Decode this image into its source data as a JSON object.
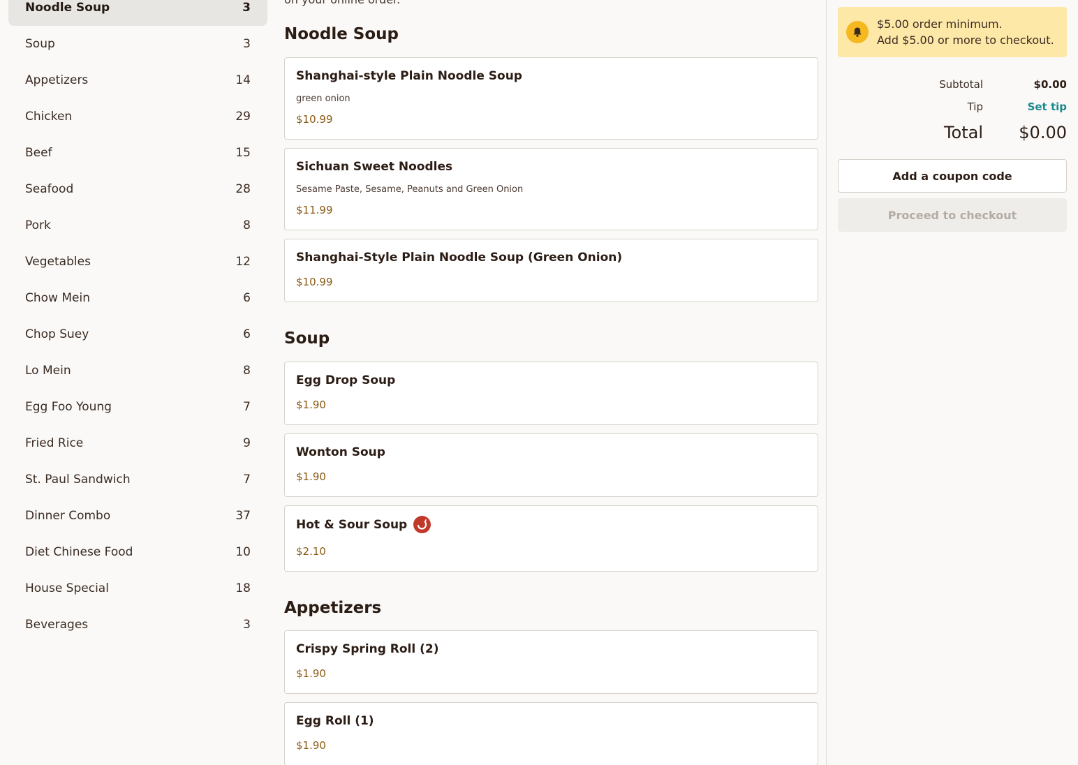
{
  "sidebar": {
    "categories": [
      {
        "label": "Noodle Soup",
        "count": "3"
      },
      {
        "label": "Soup",
        "count": "3"
      },
      {
        "label": "Appetizers",
        "count": "14"
      },
      {
        "label": "Chicken",
        "count": "29"
      },
      {
        "label": "Beef",
        "count": "15"
      },
      {
        "label": "Seafood",
        "count": "28"
      },
      {
        "label": "Pork",
        "count": "8"
      },
      {
        "label": "Vegetables",
        "count": "12"
      },
      {
        "label": "Chow Mein",
        "count": "6"
      },
      {
        "label": "Chop Suey",
        "count": "6"
      },
      {
        "label": "Lo Mein",
        "count": "8"
      },
      {
        "label": "Egg Foo Young",
        "count": "7"
      },
      {
        "label": "Fried Rice",
        "count": "9"
      },
      {
        "label": "St. Paul Sandwich",
        "count": "7"
      },
      {
        "label": "Dinner Combo",
        "count": "37"
      },
      {
        "label": "Diet Chinese Food",
        "count": "10"
      },
      {
        "label": "House Special",
        "count": "18"
      },
      {
        "label": "Beverages",
        "count": "3"
      }
    ]
  },
  "menu": {
    "intro": "on your online order.",
    "sections": [
      {
        "title": "Noodle Soup",
        "items": [
          {
            "name": "Shanghai-style Plain Noodle Soup",
            "desc": "green onion",
            "price": "$10.99"
          },
          {
            "name": "Sichuan Sweet Noodles",
            "desc": "Sesame Paste, Sesame, Peanuts and Green Onion",
            "price": "$11.99"
          },
          {
            "name": "Shanghai-Style Plain Noodle Soup (Green Onion)",
            "price": "$10.99"
          }
        ]
      },
      {
        "title": "Soup",
        "items": [
          {
            "name": "Egg Drop Soup",
            "price": "$1.90"
          },
          {
            "name": "Wonton Soup",
            "price": "$1.90"
          },
          {
            "name": "Hot & Sour Soup",
            "price": "$2.10",
            "icon": "spicy-pepper-icon"
          }
        ]
      },
      {
        "title": "Appetizers",
        "items": [
          {
            "name": "Crispy Spring Roll (2)",
            "price": "$1.90"
          },
          {
            "name": "Egg Roll (1)",
            "price": "$1.90"
          }
        ]
      }
    ]
  },
  "cart": {
    "notice_line1": "$5.00 order minimum.",
    "notice_line2": "Add $5.00 or more to checkout.",
    "subtotal_label": "Subtotal",
    "subtotal_value": "$0.00",
    "tip_label": "Tip",
    "tip_action": "Set tip",
    "total_label": "Total",
    "total_value": "$0.00",
    "coupon_label": "Add a coupon code",
    "checkout_label": "Proceed to checkout"
  },
  "colors": {
    "accent_teal": "#1a8a8c",
    "price": "#8a5a14",
    "notice_bg": "#fde8a8",
    "spicy_red": "#c0392b"
  }
}
